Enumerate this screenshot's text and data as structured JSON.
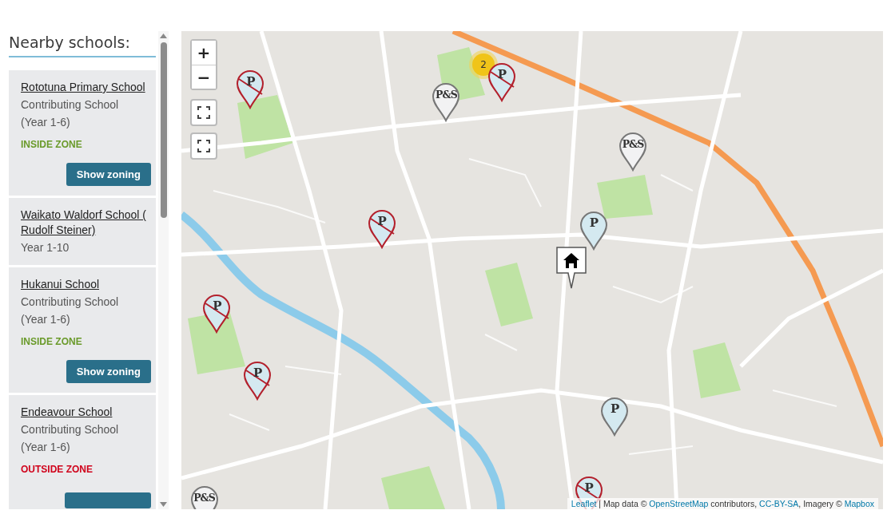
{
  "sidebar": {
    "title": "Nearby schools:",
    "schools": [
      {
        "name": "Rototuna Primary School",
        "type": "Contributing School",
        "years": "(Year 1-6)",
        "inside_zone": true,
        "zone_label": "INSIDE ZONE",
        "button": "Show zoning"
      },
      {
        "name": "Waikato Waldorf School ( Rudolf Steiner)",
        "years": "Year 1-10"
      },
      {
        "name": "Hukanui School",
        "type": "Contributing School",
        "years": "(Year 1-6)",
        "inside_zone": true,
        "zone_label": "INSIDE ZONE",
        "button": "Show zoning"
      },
      {
        "name": "Endeavour School",
        "type": "Contributing School",
        "years": "(Year 1-6)",
        "inside_zone": false,
        "zone_label": "OUTSIDE ZONE",
        "button_partly_hidden": true
      }
    ]
  },
  "map": {
    "zoom_controls": [
      "+",
      "−"
    ],
    "markers": [
      {
        "label": "P",
        "crossed": true,
        "color": "#d4e9f0"
      },
      {
        "label": "P&S",
        "crossed": false,
        "color": "#f2f2f3"
      },
      {
        "label": "P",
        "crossed": true,
        "color": "#d4e9f0"
      },
      {
        "label": "P&S",
        "crossed": false,
        "color": "#f2f2f3"
      },
      {
        "label": "P",
        "crossed": true,
        "color": "#d4e9f0"
      },
      {
        "label": "P",
        "crossed": false,
        "color": "#d4e9f0"
      },
      {
        "label": "P",
        "crossed": true,
        "color": "#d4e9f0"
      },
      {
        "label": "P",
        "crossed": true,
        "color": "#d4e9f0"
      },
      {
        "label": "P",
        "crossed": false,
        "color": "#d4e9f0"
      },
      {
        "label": "P",
        "crossed": true,
        "color": "#d4e9f0"
      },
      {
        "label": "P&S",
        "crossed": false,
        "color": "#f2f2f3"
      }
    ],
    "clusters": [
      {
        "count": "2"
      }
    ],
    "attribution": [
      {
        "text": "Leaflet",
        "link": true
      },
      {
        "text": " | Map data © ",
        "link": false
      },
      {
        "text": "OpenStreetMap",
        "link": true
      },
      {
        "text": " contributors, ",
        "link": false
      },
      {
        "text": "CC-BY-SA",
        "link": true
      },
      {
        "text": ", Imagery © ",
        "link": false
      },
      {
        "text": "Mapbox",
        "link": true
      }
    ]
  }
}
